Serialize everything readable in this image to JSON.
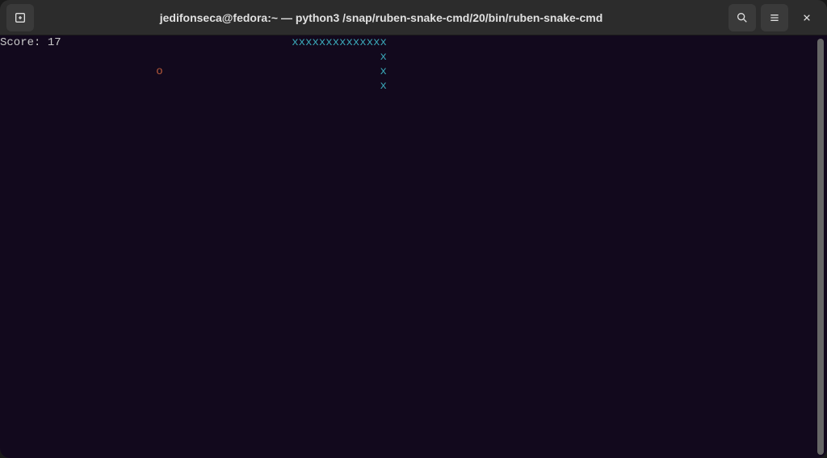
{
  "titlebar": {
    "title": "jedifonseca@fedora:~ — python3 /snap/ruben-snake-cmd/20/bin/ruben-snake-cmd"
  },
  "game": {
    "score_label": "Score: ",
    "score_value": "17",
    "snake_row1": "xxxxxxxxxxxxxx",
    "snake_row2": "x",
    "snake_row3": "x",
    "snake_row4": "x",
    "food_char": "o",
    "snake_col_start": 43,
    "snake_tail_col": 56,
    "food_col": 23
  },
  "colors": {
    "terminal_bg": "#12091d",
    "snake_color": "#3aa8b8",
    "food_color": "#b85a3a",
    "text_color": "#c8c8c8"
  }
}
